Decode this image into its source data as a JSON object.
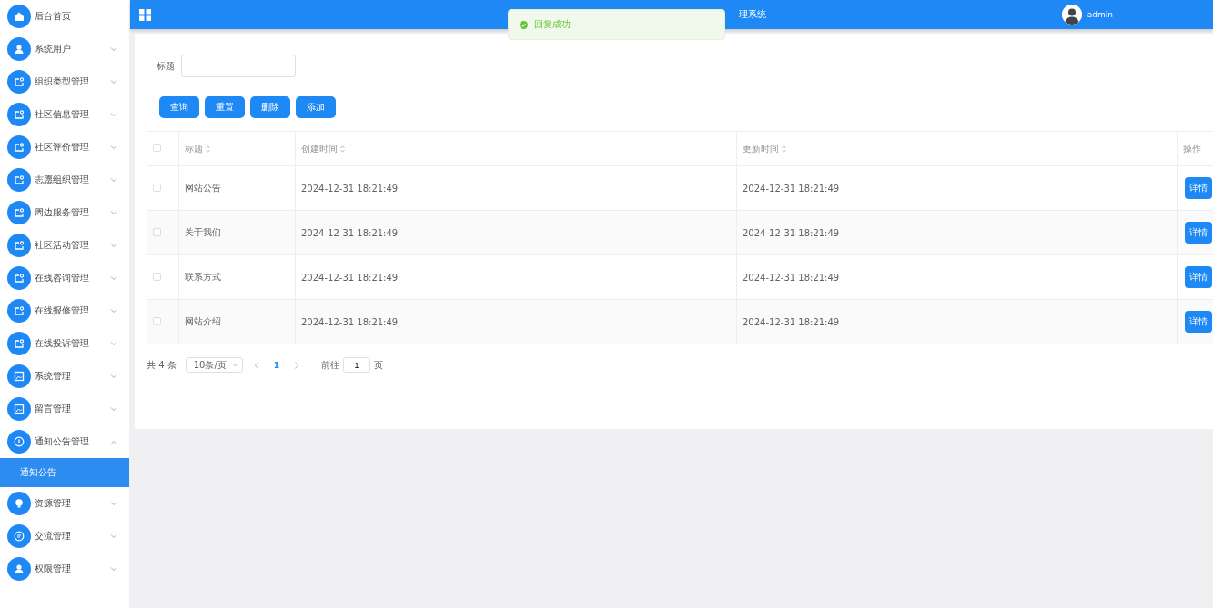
{
  "sidebar": {
    "items": [
      {
        "label": "后台首页",
        "kind": "home"
      },
      {
        "label": "系统用户",
        "kind": "user",
        "expanded": false
      },
      {
        "label": "组织类型管理",
        "kind": "doc",
        "expanded": false
      },
      {
        "label": "社区信息管理",
        "kind": "doc",
        "expanded": false
      },
      {
        "label": "社区评价管理",
        "kind": "doc",
        "expanded": false
      },
      {
        "label": "志愿组织管理",
        "kind": "doc",
        "expanded": false
      },
      {
        "label": "周边服务管理",
        "kind": "doc",
        "expanded": false
      },
      {
        "label": "社区活动管理",
        "kind": "doc",
        "expanded": false
      },
      {
        "label": "在线咨询管理",
        "kind": "doc",
        "expanded": false
      },
      {
        "label": "在线报修管理",
        "kind": "doc",
        "expanded": false
      },
      {
        "label": "在线投诉管理",
        "kind": "doc",
        "expanded": false
      },
      {
        "label": "系统管理",
        "kind": "image",
        "expanded": false
      },
      {
        "label": "留言管理",
        "kind": "image",
        "expanded": false
      },
      {
        "label": "通知公告管理",
        "kind": "info",
        "expanded": true,
        "children": [
          {
            "label": "通知公告",
            "selected": true
          }
        ]
      },
      {
        "label": "资源管理",
        "kind": "bulb",
        "expanded": false
      },
      {
        "label": "交流管理",
        "kind": "chat",
        "expanded": false
      },
      {
        "label": "权限管理",
        "kind": "user",
        "expanded": false
      }
    ]
  },
  "header": {
    "title": "理系统",
    "user": "admin"
  },
  "toast": {
    "message": "回复成功"
  },
  "search": {
    "label": "标题"
  },
  "buttons": [
    "查询",
    "重置",
    "删除",
    "添加"
  ],
  "table": {
    "all_checked": false,
    "columns": [
      {
        "label": "标题",
        "sortable": true
      },
      {
        "label": "创建时间",
        "sortable": true
      },
      {
        "label": "更新时间",
        "sortable": true
      },
      {
        "label": "操作",
        "sortable": false
      }
    ],
    "rows": [
      {
        "checked": false,
        "title": "网站公告",
        "created": "2024-12-31 18:21:49",
        "updated": "2024-12-31 18:21:49",
        "action": "详情"
      },
      {
        "checked": false,
        "title": "关于我们",
        "created": "2024-12-31 18:21:49",
        "updated": "2024-12-31 18:21:49",
        "action": "详情"
      },
      {
        "checked": false,
        "title": "联系方式",
        "created": "2024-12-31 18:21:49",
        "updated": "2024-12-31 18:21:49",
        "action": "详情"
      },
      {
        "checked": false,
        "title": "网站介绍",
        "created": "2024-12-31 18:21:49",
        "updated": "2024-12-31 18:21:49",
        "action": "详情"
      }
    ]
  },
  "pagination": {
    "total": "共 4 条",
    "page_size": "10条/页",
    "pages": [
      {
        "label": "1",
        "selected": true
      }
    ],
    "goto_label": "前往",
    "goto_value": "1",
    "goto_suffix": "页"
  }
}
